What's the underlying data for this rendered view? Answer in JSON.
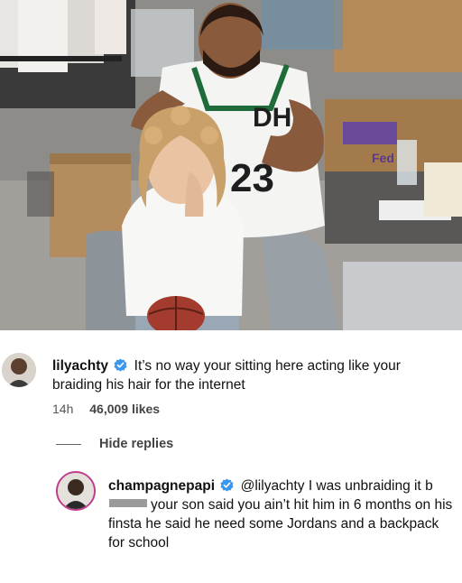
{
  "comment": {
    "username": "lilyachty",
    "text": "It’s no way your sitting here acting like your braiding his hair for the internet",
    "time": "14h",
    "likes": "46,009 likes",
    "avatar_icon": "profile-avatar"
  },
  "replies_toggle": "Hide replies",
  "reply": {
    "username": "champagnepapi",
    "mention": "@lilyachty",
    "text_part1": "I was unbraiding it",
    "text_part1_prefix": "b",
    "text_part2": "your son said you ain’t hit him in 6 months on his finsta he said he need some Jordans and a backpack for school",
    "avatar_icon": "profile-avatar"
  },
  "photo": {
    "jersey_number": "23",
    "jersey_letters": "DH",
    "box_label": "Fed"
  },
  "colors": {
    "verified": "#3897f0",
    "text": "#111111",
    "meta": "#555555"
  }
}
